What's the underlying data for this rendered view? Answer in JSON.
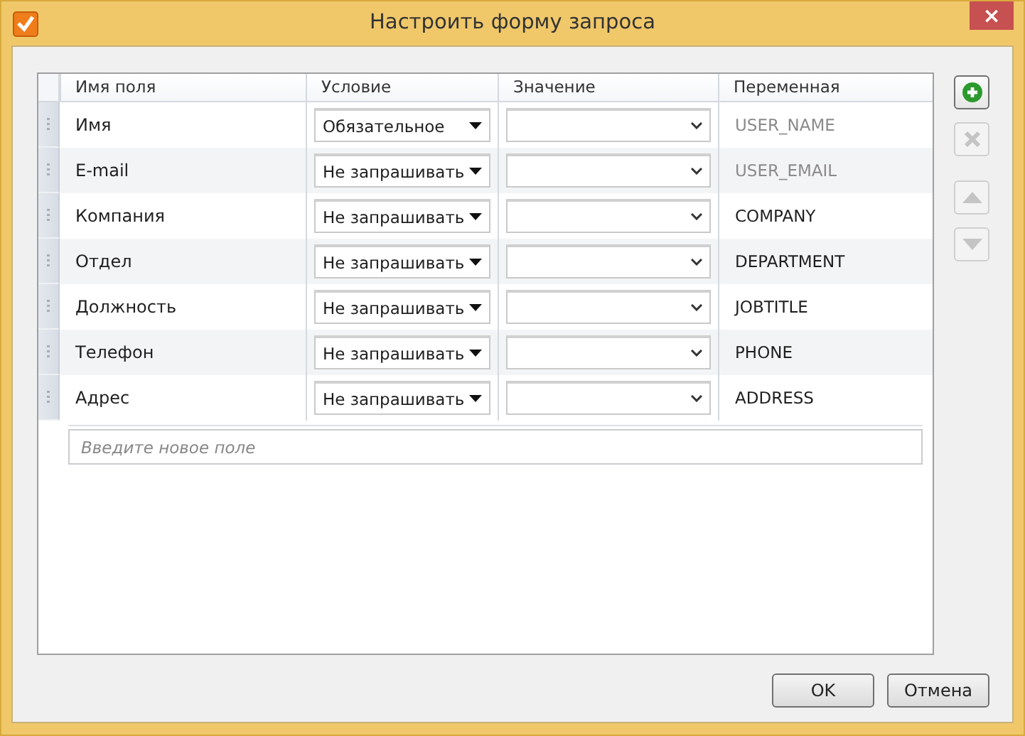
{
  "window": {
    "title": "Настроить форму запроса",
    "close": "×"
  },
  "table": {
    "columns": [
      "Имя поля",
      "Условие",
      "Значение",
      "Переменная"
    ],
    "rows": [
      {
        "name": "Имя",
        "condition": "Обязательное",
        "value": "",
        "variable": "USER_NAME",
        "disabled": true
      },
      {
        "name": "E-mail",
        "condition": "Не запрашивать",
        "value": "",
        "variable": "USER_EMAIL",
        "disabled": true
      },
      {
        "name": "Компания",
        "condition": "Не запрашивать",
        "value": "",
        "variable": "COMPANY",
        "disabled": false
      },
      {
        "name": "Отдел",
        "condition": "Не запрашивать",
        "value": "",
        "variable": "DEPARTMENT",
        "disabled": false
      },
      {
        "name": "Должность",
        "condition": "Не запрашивать",
        "value": "",
        "variable": "JOBTITLE",
        "disabled": false
      },
      {
        "name": "Телефон",
        "condition": "Не запрашивать",
        "value": "",
        "variable": "PHONE",
        "disabled": false
      },
      {
        "name": "Адрес",
        "condition": "Не запрашивать",
        "value": "",
        "variable": "ADDRESS",
        "disabled": false
      }
    ],
    "new_field": {
      "placeholder": "Введите новое поле"
    }
  },
  "side_buttons": [
    {
      "kind": "add",
      "disabled": false
    },
    {
      "kind": "delete",
      "disabled": true
    },
    {
      "kind": "up",
      "disabled": true
    },
    {
      "kind": "down",
      "disabled": true
    }
  ],
  "buttons": [
    "OK",
    "Отмена"
  ]
}
